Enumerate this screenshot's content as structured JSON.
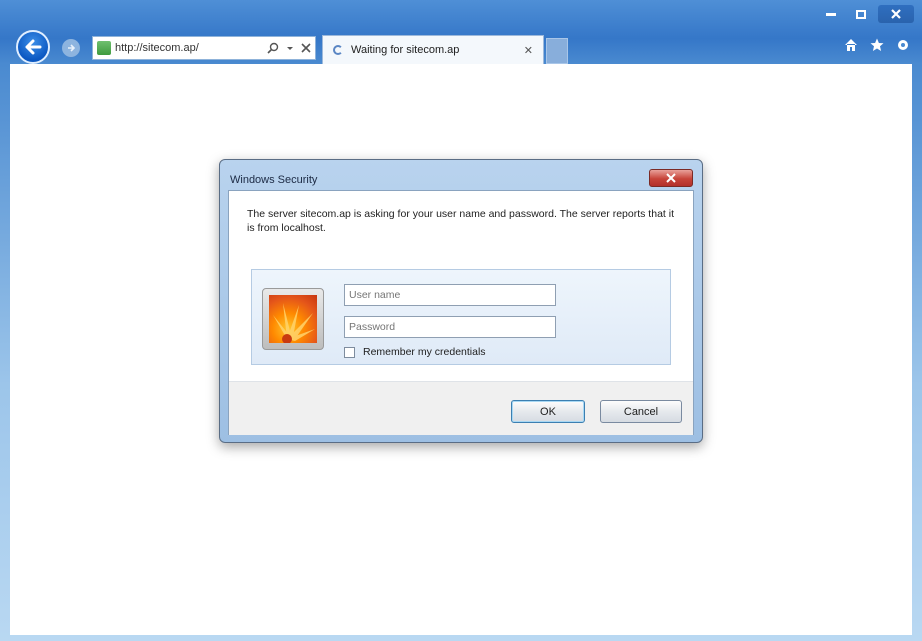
{
  "browser": {
    "address_url": "http://sitecom.ap/",
    "tab_title": "Waiting for sitecom.ap",
    "window_controls": [
      "minimize",
      "maximize",
      "close"
    ],
    "toolbar_icons": [
      "home-icon",
      "favorites-star-icon",
      "tools-gear-icon"
    ]
  },
  "dialog": {
    "title": "Windows Security",
    "message": "The server sitecom.ap is asking for your user name and password. The server reports that it is from localhost.",
    "username_placeholder": "User name",
    "password_placeholder": "Password",
    "remember_label": "Remember my credentials",
    "ok_label": "OK",
    "cancel_label": "Cancel"
  },
  "colors": {
    "title_bar_blue": "#3577c8",
    "dialog_close_red": "#c7443a"
  }
}
